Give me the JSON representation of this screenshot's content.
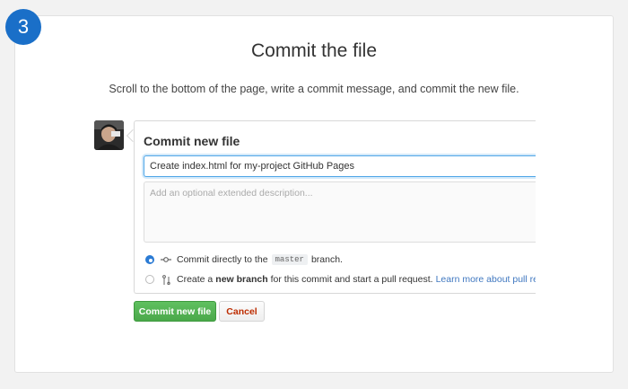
{
  "step": {
    "number": "3"
  },
  "header": {
    "title": "Commit the file",
    "subtitle": "Scroll to the bottom of the page, write a commit message, and commit the new file."
  },
  "commit_panel": {
    "title": "Commit new file",
    "message_value": "Create index.html for my-project GitHub Pages",
    "description_placeholder": "Add an optional extended description...",
    "option_direct": {
      "prefix": "Commit directly to the",
      "branch": "master",
      "suffix": "branch.",
      "selected": true
    },
    "option_new_branch": {
      "prefix": "Create a",
      "bold": "new branch",
      "suffix": "for this commit and start a pull request.",
      "link": "Learn more about pull reque",
      "selected": false
    }
  },
  "buttons": {
    "commit_label": "Commit new file",
    "cancel_label": "Cancel"
  },
  "colors": {
    "accent": "#1a6fc8",
    "commit_green": "#4aa84a",
    "cancel_red": "#bd2c00",
    "link_blue": "#4078c0"
  },
  "icons": {
    "direct_commit": "git-commit-icon",
    "new_branch": "git-pull-request-icon"
  }
}
